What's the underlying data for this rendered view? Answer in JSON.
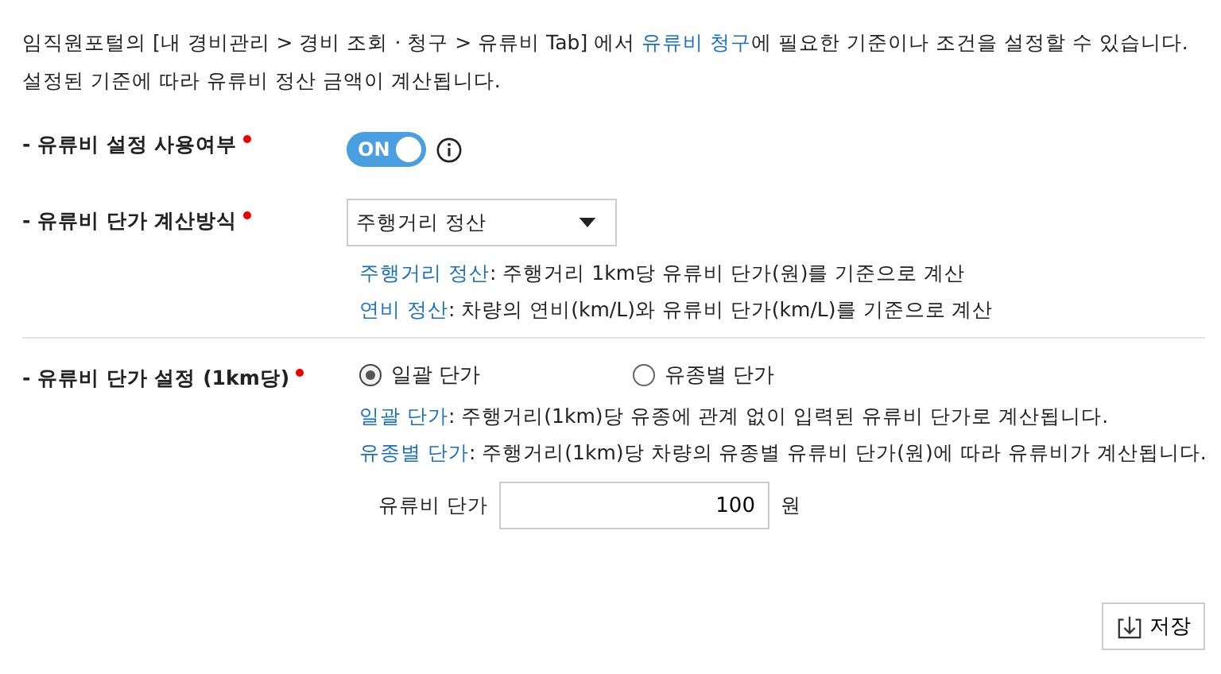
{
  "intro": {
    "before": "임직원포털의 [내 경비관리 > 경비 조회 · 청구 > 유류비 Tab] 에서 ",
    "link": "유류비 청구",
    "after": "에 필요한 기준이나 조건을 설정할 수 있습니다.",
    "line2": "설정된 기준에 따라 유류비 정산 금액이 계산됩니다."
  },
  "use_setting": {
    "label": "- 유류비 설정 사용여부",
    "required": true,
    "toggle": {
      "on": true,
      "text": "ON"
    }
  },
  "calc_method": {
    "label": "- 유류비 단가 계산방식",
    "required": true,
    "value": "주행거리 정산",
    "notes": [
      {
        "term": "주행거리 정산",
        "text": ": 주행거리 1km당 유류비 단가(원)를 기준으로 계산"
      },
      {
        "term": "연비 정산",
        "text": ": 차량의 연비(km/L)와 유류비 단가(km/L)를 기준으로 계산"
      }
    ]
  },
  "price_setting": {
    "label": "- 유류비 단가 설정 (1km당)",
    "required": true,
    "options": [
      {
        "label": "일괄 단가",
        "selected": true
      },
      {
        "label": "유종별 단가",
        "selected": false
      }
    ],
    "notes": [
      {
        "term": "일괄 단가",
        "text": ": 주행거리(1km)당 유종에 관계 없이 입력된 유류비 단가로 계산됩니다."
      },
      {
        "term": "유종별 단가",
        "text": ": 주행거리(1km)당 차량의 유종별 유류비 단가(원)에 따라 유류비가 계산됩니다."
      }
    ],
    "price_label": "유류비 단가",
    "price_value": "100",
    "unit": "원"
  },
  "save_button": "저장"
}
